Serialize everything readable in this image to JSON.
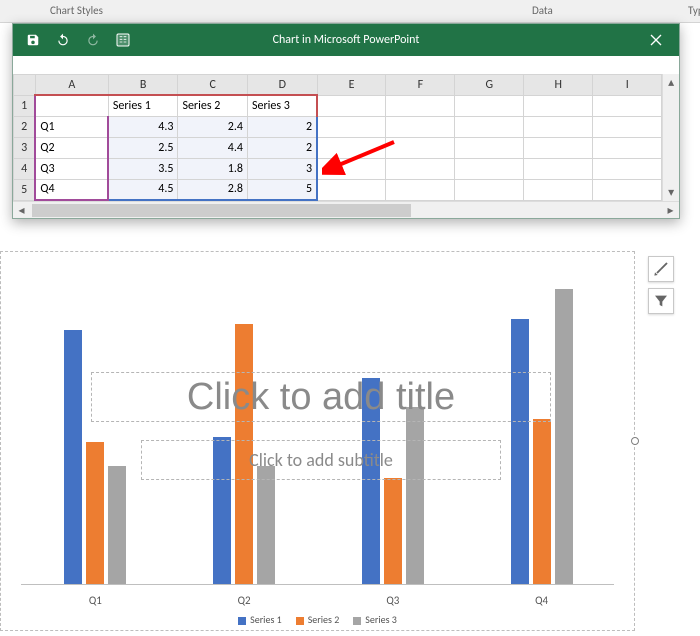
{
  "ribbon": {
    "chart_styles": "Chart Styles",
    "data_group": "Data",
    "type_group": "Type"
  },
  "data_window": {
    "title": "Chart in Microsoft PowerPoint",
    "columns": [
      "A",
      "B",
      "C",
      "D",
      "E",
      "F",
      "G",
      "H",
      "I"
    ],
    "row_numbers": [
      "1",
      "2",
      "3",
      "4",
      "5"
    ],
    "headers": [
      "",
      "Series 1",
      "Series 2",
      "Series 3"
    ],
    "rows": [
      [
        "Q1",
        "4.3",
        "2.4",
        "2"
      ],
      [
        "Q2",
        "2.5",
        "4.4",
        "2"
      ],
      [
        "Q3",
        "3.5",
        "1.8",
        "3"
      ],
      [
        "Q4",
        "4.5",
        "2.8",
        "5"
      ]
    ]
  },
  "slide": {
    "title_placeholder": "Click to add title",
    "subtitle_placeholder": "Click to add subtitle"
  },
  "legend": {
    "s1": "Series 1",
    "s2": "Series 2",
    "s3": "Series 3"
  },
  "chart_data": {
    "type": "bar",
    "categories": [
      "Q1",
      "Q2",
      "Q3",
      "Q4"
    ],
    "series": [
      {
        "name": "Series 1",
        "color": "#4472c4",
        "values": [
          4.3,
          2.5,
          3.5,
          4.5
        ]
      },
      {
        "name": "Series 2",
        "color": "#ed7d31",
        "values": [
          2.4,
          4.4,
          1.8,
          2.8
        ]
      },
      {
        "name": "Series 3",
        "color": "#a5a5a5",
        "values": [
          2,
          2,
          3,
          5
        ]
      }
    ],
    "ylim": [
      0,
      5
    ],
    "xlabel": "",
    "ylabel": "",
    "title": ""
  }
}
